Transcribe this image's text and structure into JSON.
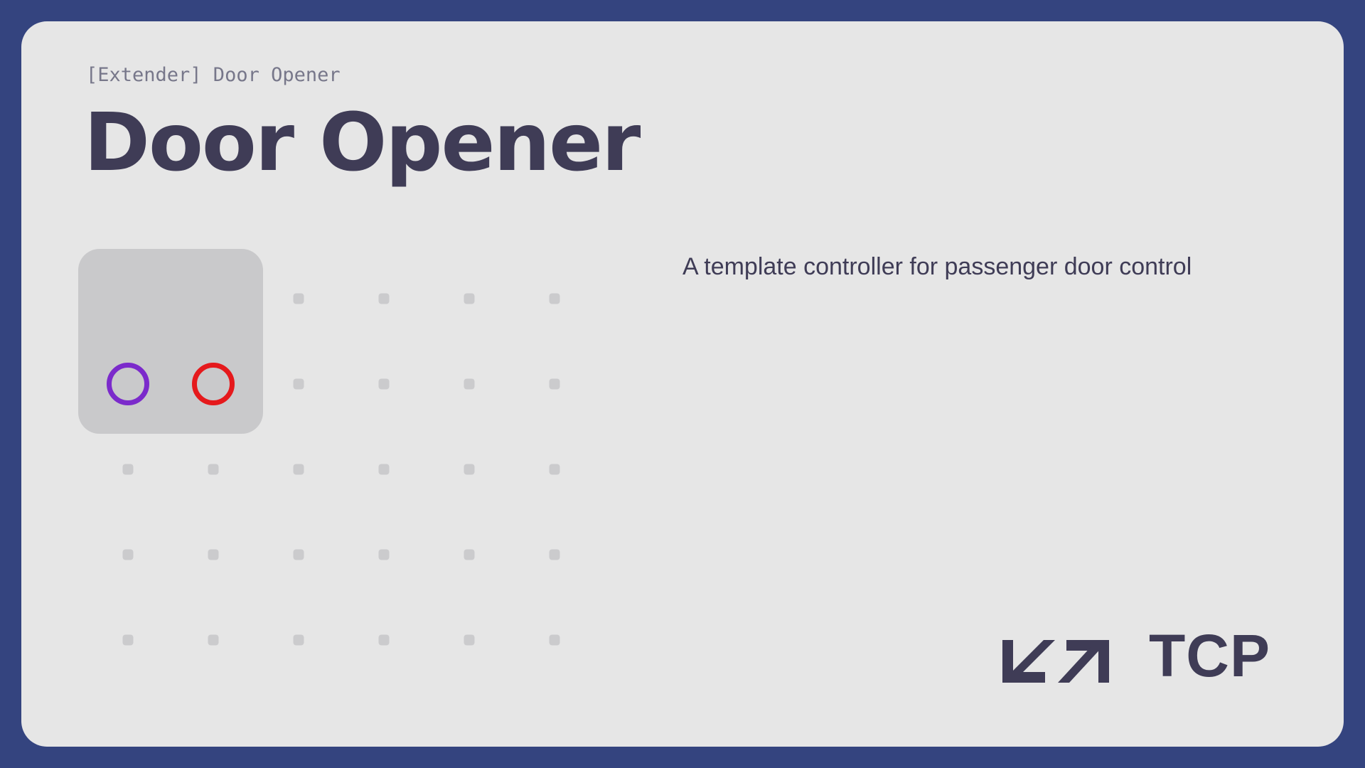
{
  "header": {
    "subtitle": "[Extender] Door Opener",
    "title": "Door Opener"
  },
  "description": "A template controller for passenger door control",
  "device": {
    "buttons": [
      {
        "name": "purple-ring",
        "color": "#7b2acb"
      },
      {
        "name": "red-ring",
        "color": "#e5191c"
      }
    ]
  },
  "colors": {
    "frame": "#34447f",
    "card": "#e6e6e6",
    "text": "#3f3c56",
    "dot": "#cbcbcd",
    "device": "#c9c9cb"
  },
  "logo": {
    "icon": "tcp-arrows-icon",
    "text": "TCP"
  }
}
